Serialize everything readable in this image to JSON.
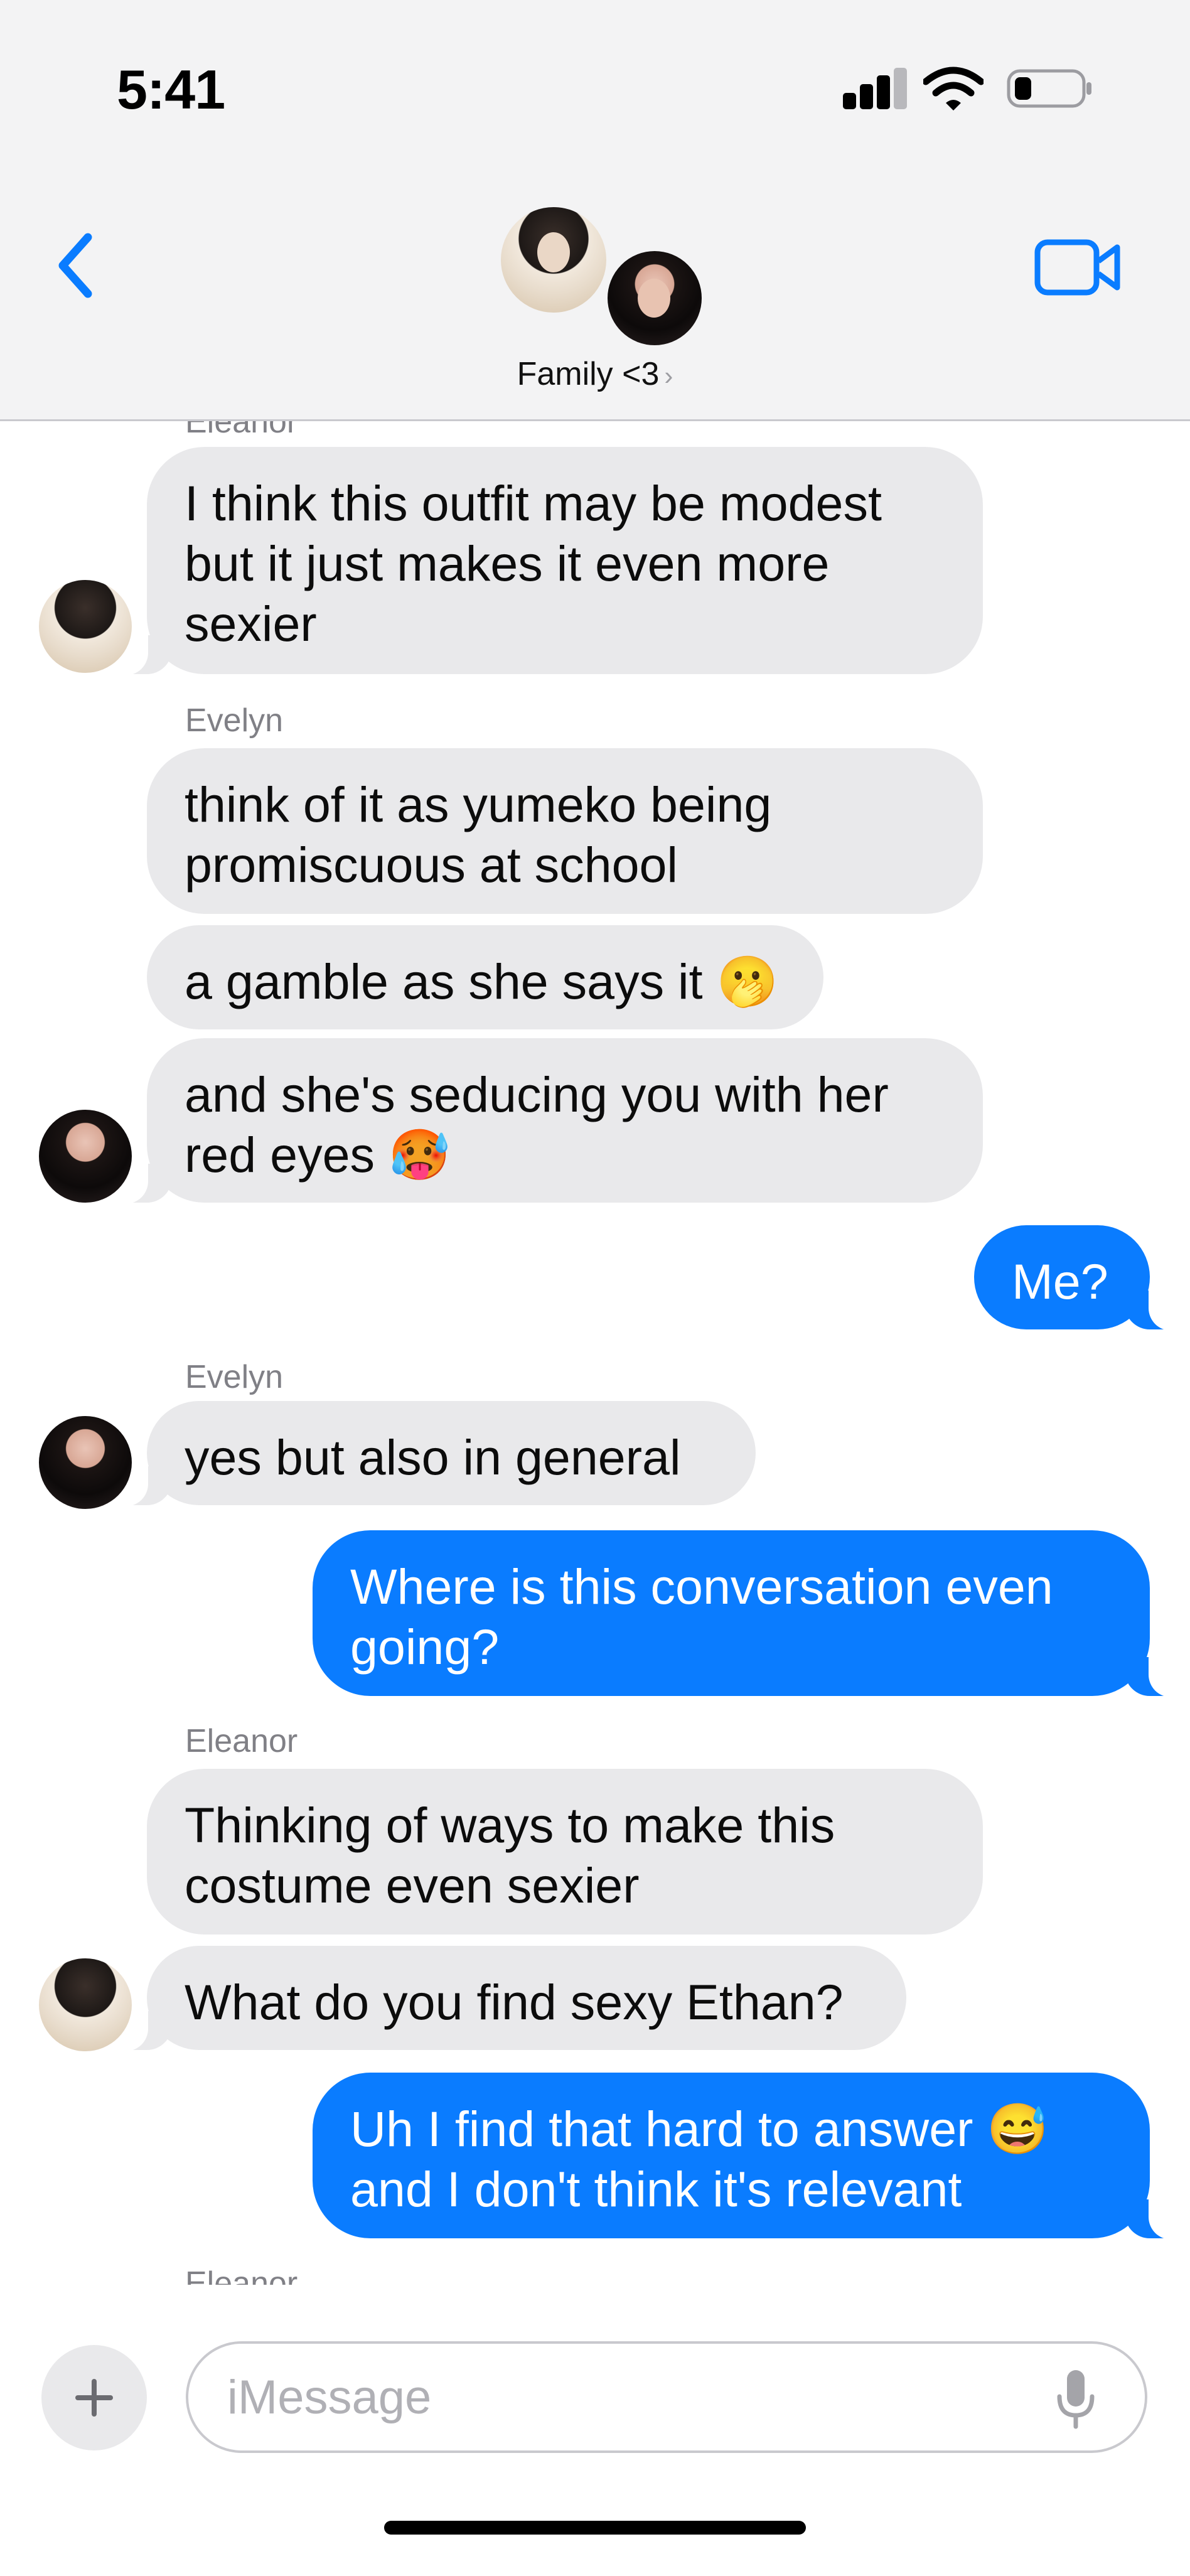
{
  "status_bar": {
    "time": "5:41"
  },
  "header": {
    "group_name": "Family <3",
    "chevron": "›"
  },
  "icons": {
    "back": "chevron-left-icon",
    "video": "video-camera-icon",
    "signal": "cellular-signal-icon",
    "wifi": "wifi-icon",
    "battery": "battery-low-icon",
    "plus": "plus-icon",
    "mic": "microphone-icon"
  },
  "colors": {
    "outgoing": "#0a7cff",
    "incoming": "#e9e9eb",
    "accent": "#0a7cff"
  },
  "messages": [
    {
      "sender": "Eleanor",
      "text": "I think this outfit may be modest but it just makes it even more sexier",
      "from_me": false
    },
    {
      "sender": "Evelyn",
      "text": "think of it as yumeko being promiscuous at school",
      "from_me": false
    },
    {
      "text": "a gamble as she says it 🫢",
      "from_me": false
    },
    {
      "text": "and she's seducing you with her red eyes 🥵",
      "from_me": false
    },
    {
      "text": "Me?",
      "from_me": true
    },
    {
      "sender": "Evelyn",
      "text": "yes but also in general",
      "from_me": false
    },
    {
      "text": "Where is this conversation even going?",
      "from_me": true
    },
    {
      "sender": "Eleanor",
      "text": "Thinking of ways to make this costume even sexier",
      "from_me": false
    },
    {
      "text": "What do you find sexy Ethan?",
      "from_me": false
    },
    {
      "text": "Uh I find that hard to answer 😅 and I don't think it's relevant",
      "from_me": true
    },
    {
      "sender": "Eleanor"
    }
  ],
  "composer": {
    "placeholder": "iMessage"
  }
}
